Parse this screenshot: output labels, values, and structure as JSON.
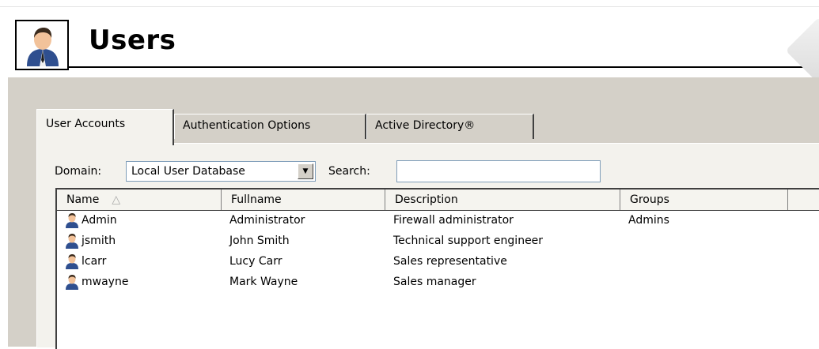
{
  "page": {
    "title": "Users"
  },
  "tabs": [
    {
      "label": "User Accounts",
      "active": true
    },
    {
      "label": "Authentication Options",
      "active": false
    },
    {
      "label": "Active Directory®",
      "active": false
    }
  ],
  "filters": {
    "domain_label": "Domain:",
    "domain_value": "Local User Database",
    "search_label": "Search:",
    "search_value": ""
  },
  "table": {
    "columns": [
      "Name",
      "Fullname",
      "Description",
      "Groups"
    ],
    "sort_indicator": "△",
    "rows": [
      {
        "name": "Admin",
        "fullname": "Administrator",
        "description": "Firewall administrator",
        "groups": "Admins"
      },
      {
        "name": "jsmith",
        "fullname": "John Smith",
        "description": "Technical support engineer",
        "groups": ""
      },
      {
        "name": "lcarr",
        "fullname": "Lucy Carr",
        "description": "Sales representative",
        "groups": ""
      },
      {
        "name": "mwayne",
        "fullname": "Mark Wayne",
        "description": "Sales manager",
        "groups": ""
      }
    ]
  },
  "icons": {
    "logo": "user-icon",
    "row": "user-icon"
  },
  "colors": {
    "panel": "#d4d0c8",
    "tab_body": "#f3f2ed",
    "field_border": "#7f9db9"
  }
}
